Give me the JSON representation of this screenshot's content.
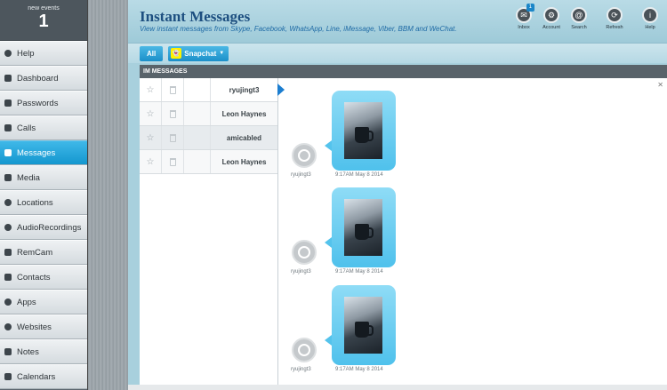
{
  "events": {
    "label": "new events",
    "count": "1"
  },
  "sidebar": {
    "items": [
      {
        "label": "Help",
        "icon": "info-icon"
      },
      {
        "label": "Dashboard",
        "icon": "rocket-icon"
      },
      {
        "label": "Passwords",
        "icon": "lock-icon"
      },
      {
        "label": "Calls",
        "icon": "phone-icon"
      },
      {
        "label": "Messages",
        "icon": "message-icon",
        "active": true
      },
      {
        "label": "Media",
        "icon": "image-icon"
      },
      {
        "label": "Locations",
        "icon": "location-icon"
      },
      {
        "label": "AudioRecordings",
        "icon": "microphone-icon"
      },
      {
        "label": "RemCam",
        "icon": "camera-icon"
      },
      {
        "label": "Contacts",
        "icon": "contacts-icon"
      },
      {
        "label": "Apps",
        "icon": "gear-icon"
      },
      {
        "label": "Websites",
        "icon": "link-icon"
      },
      {
        "label": "Notes",
        "icon": "pencil-icon"
      },
      {
        "label": "Calendars",
        "icon": "calendar-icon"
      }
    ]
  },
  "header": {
    "title": "Instant Messages",
    "subtitle": "View instant messages from Skype, Facebook, WhatsApp, Line, iMessage, Viber, BBM and WeChat.",
    "buttons": [
      {
        "label": "Inbox",
        "icon": "inbox-icon",
        "badge": "1"
      },
      {
        "label": "Account",
        "icon": "gear-icon"
      },
      {
        "label": "Search",
        "icon": "at-icon"
      },
      {
        "label": "Refresh",
        "icon": "refresh-icon"
      },
      {
        "label": "Help",
        "icon": "info-icon"
      }
    ]
  },
  "toolbar": {
    "all_label": "All",
    "app_label": "Snapchat"
  },
  "panel": {
    "heading": "IM MESSAGES"
  },
  "threads": [
    {
      "name": "ryujingt3"
    },
    {
      "name": "Leon Haynes"
    },
    {
      "name": "amicabled"
    },
    {
      "name": "Leon Haynes"
    }
  ],
  "messages": [
    {
      "sender": "ryujingt3",
      "timestamp": "9:17AM May 8 2014"
    },
    {
      "sender": "ryujingt3",
      "timestamp": "9:17AM May 8 2014"
    },
    {
      "sender": "ryujingt3",
      "timestamp": "9:17AM May 8 2014"
    }
  ],
  "colors": {
    "accent": "#1b9bd6",
    "title": "#1d4f80",
    "header_bg": "#a8d0dd"
  }
}
